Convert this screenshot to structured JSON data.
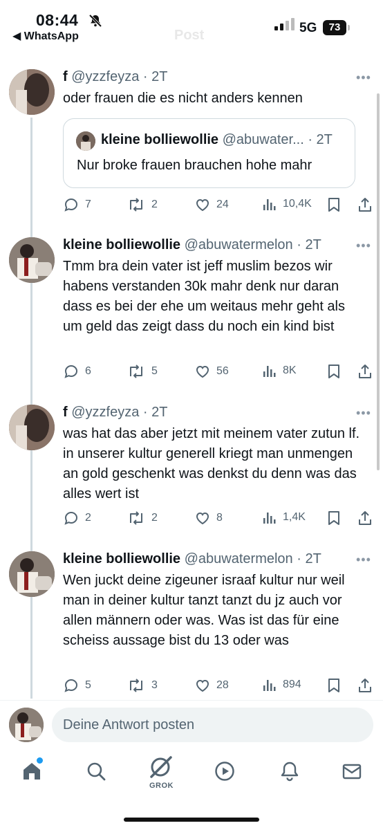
{
  "status_bar": {
    "time": "08:44",
    "back_app": "◀ WhatsApp",
    "network": "5G",
    "battery": "73",
    "title_ghost": "Post"
  },
  "tweets": [
    {
      "name": "f",
      "handle": "@yzzfeyza",
      "time": "· 2T",
      "text": "oder frauen die es nicht anders kennen",
      "quote": {
        "name": "kleine bolliewollie",
        "handle": "@abuwater...",
        "time": "· 2T",
        "text": "Nur broke frauen brauchen hohe mahr"
      },
      "replies": "7",
      "reposts": "2",
      "likes": "24",
      "views": "10,4K"
    },
    {
      "name": "kleine bolliewollie",
      "handle": "@abuwatermelon",
      "time": "· 2T",
      "text": "Tmm bra dein vater ist jeff muslim bezos wir habens verstanden 30k mahr denk nur daran dass es bei der ehe um weitaus mehr geht als um geld das zeigt dass du noch ein kind bist",
      "replies": "6",
      "reposts": "5",
      "likes": "56",
      "views": "8K"
    },
    {
      "name": "f",
      "handle": "@yzzfeyza",
      "time": "· 2T",
      "text": "was hat das aber jetzt mit meinem vater zutun lf. in unserer kultur generell kriegt man unmengen an gold geschenkt was denkst du denn was das alles wert ist",
      "replies": "2",
      "reposts": "2",
      "likes": "8",
      "views": "1,4K"
    },
    {
      "name": "kleine bolliewollie",
      "handle": "@abuwatermelon",
      "time": "· 2T",
      "text": "Wen juckt deine zigeuner israaf kultur nur weil man in deiner kultur tanzt tanzt du jz auch vor allen männern oder was. Was ist das für eine scheiss aussage bist du 13 oder was",
      "replies": "5",
      "reposts": "3",
      "likes": "28",
      "views": "894"
    }
  ],
  "reply_bar": {
    "placeholder": "Deine Antwort posten"
  },
  "tab_bar": {
    "grok_label": "GROK",
    "items": [
      "home-icon",
      "search-icon",
      "grok-icon",
      "play-icon",
      "bell-icon",
      "mail-icon"
    ]
  },
  "colors": {
    "accent": "#1d9bf0",
    "text": "#0f1419",
    "muted": "#536471",
    "border": "#cfd9de"
  }
}
